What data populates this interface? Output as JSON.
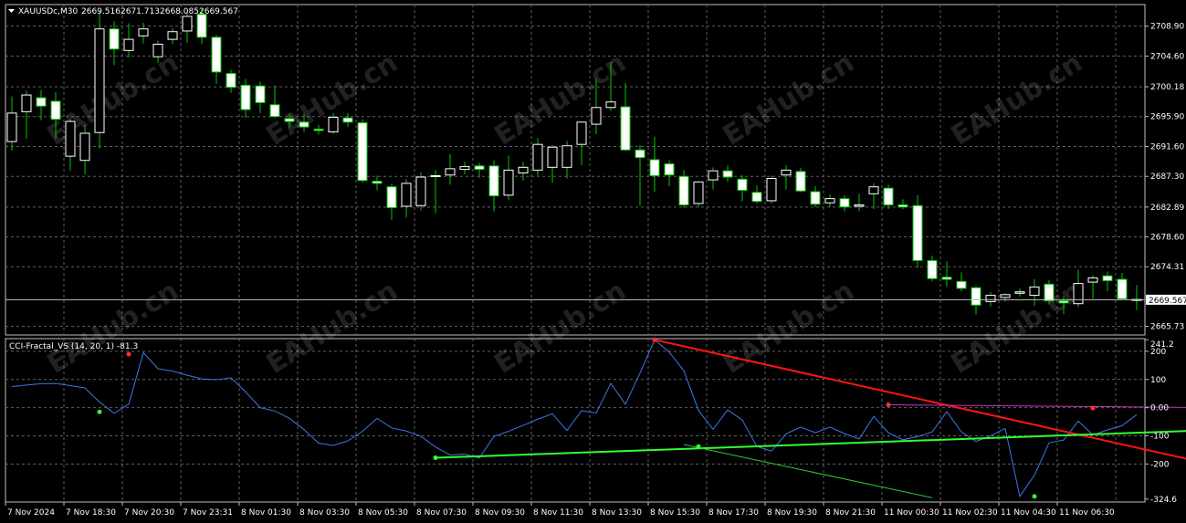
{
  "symbol_header": {
    "symbol": "XAUUSDc,M30",
    "open": "2669.516",
    "high": "2671.713",
    "low": "2668.085",
    "close": "2669.567"
  },
  "price_axis": {
    "labels": [
      "2708.90",
      "2704.60",
      "2700.18",
      "2695.90",
      "2691.60",
      "2687.30",
      "2682.89",
      "2678.60",
      "2674.31",
      "2665.73"
    ],
    "current_price": "2669.567"
  },
  "indicator": {
    "label": "CCI-Fractal_VS (14, 20, 1) -81.3",
    "axis_labels": [
      "241.2",
      "200",
      "100",
      "0.00",
      "-100",
      "-200",
      "-324.6"
    ]
  },
  "time_axis": {
    "labels": [
      "7 Nov 2024",
      "7 Nov 18:30",
      "7 Nov 20:30",
      "7 Nov 23:31",
      "8 Nov 01:30",
      "8 Nov 03:30",
      "8 Nov 05:30",
      "8 Nov 07:30",
      "8 Nov 09:30",
      "8 Nov 11:30",
      "8 Nov 13:30",
      "8 Nov 15:30",
      "8 Nov 17:30",
      "8 Nov 19:30",
      "8 Nov 21:30",
      "11 Nov 00:30",
      "11 Nov 02:30",
      "11 Nov 04:30",
      "11 Nov 06:30"
    ]
  },
  "watermark": "EAHub.cn",
  "colors": {
    "background": "#000000",
    "grid": "#606060",
    "candle_bull": "#ffffff",
    "candle_bear": "#ffffff",
    "wick": "#00c800",
    "cci_line": "#3c78e6",
    "trend_red": "#ff1414",
    "trend_green": "#32ff32",
    "trend_magenta": "#c832c8"
  },
  "chart_data": {
    "type": "candlestick",
    "symbol": "XAUUSDc",
    "timeframe": "M30",
    "ylim": [
      2664.5,
      2712.0
    ],
    "candles": [
      {
        "o": 2692.3,
        "h": 2698.8,
        "l": 2691.0,
        "c": 2696.4
      },
      {
        "o": 2696.6,
        "h": 2699.6,
        "l": 2692.7,
        "c": 2699.0
      },
      {
        "o": 2698.6,
        "h": 2699.7,
        "l": 2695.4,
        "c": 2697.4
      },
      {
        "o": 2698.1,
        "h": 2699.4,
        "l": 2692.7,
        "c": 2695.5
      },
      {
        "o": 2690.2,
        "h": 2695.5,
        "l": 2688.1,
        "c": 2695.2
      },
      {
        "o": 2689.6,
        "h": 2694.7,
        "l": 2687.6,
        "c": 2693.5
      },
      {
        "o": 2693.6,
        "h": 2711.1,
        "l": 2691.3,
        "c": 2708.5
      },
      {
        "o": 2708.5,
        "h": 2709.6,
        "l": 2703.3,
        "c": 2705.6
      },
      {
        "o": 2705.4,
        "h": 2709.3,
        "l": 2704.4,
        "c": 2707.0
      },
      {
        "o": 2707.5,
        "h": 2709.4,
        "l": 2706.4,
        "c": 2708.5
      },
      {
        "o": 2704.5,
        "h": 2706.8,
        "l": 2703.6,
        "c": 2706.3
      },
      {
        "o": 2707.0,
        "h": 2708.6,
        "l": 2706.3,
        "c": 2708.1
      },
      {
        "o": 2708.2,
        "h": 2711.2,
        "l": 2706.5,
        "c": 2710.3
      },
      {
        "o": 2710.6,
        "h": 2711.5,
        "l": 2706.3,
        "c": 2707.3
      },
      {
        "o": 2707.3,
        "h": 2707.6,
        "l": 2700.6,
        "c": 2702.3
      },
      {
        "o": 2702.1,
        "h": 2702.6,
        "l": 2699.3,
        "c": 2700.1
      },
      {
        "o": 2700.4,
        "h": 2701.3,
        "l": 2695.7,
        "c": 2696.9
      },
      {
        "o": 2700.3,
        "h": 2700.9,
        "l": 2696.4,
        "c": 2697.9
      },
      {
        "o": 2697.6,
        "h": 2700.4,
        "l": 2695.7,
        "c": 2695.9
      },
      {
        "o": 2695.6,
        "h": 2696.3,
        "l": 2694.2,
        "c": 2695.2
      },
      {
        "o": 2695.1,
        "h": 2696.3,
        "l": 2693.7,
        "c": 2694.4
      },
      {
        "o": 2694.1,
        "h": 2694.7,
        "l": 2693.3,
        "c": 2693.9
      },
      {
        "o": 2693.7,
        "h": 2696.4,
        "l": 2693.4,
        "c": 2695.8
      },
      {
        "o": 2695.7,
        "h": 2696.4,
        "l": 2694.4,
        "c": 2695.1
      },
      {
        "o": 2695.0,
        "h": 2695.5,
        "l": 2686.4,
        "c": 2686.7
      },
      {
        "o": 2686.6,
        "h": 2687.4,
        "l": 2685.3,
        "c": 2686.3
      },
      {
        "o": 2685.8,
        "h": 2686.2,
        "l": 2681.0,
        "c": 2682.8
      },
      {
        "o": 2683.0,
        "h": 2686.9,
        "l": 2681.4,
        "c": 2686.3
      },
      {
        "o": 2683.1,
        "h": 2687.9,
        "l": 2682.4,
        "c": 2687.2
      },
      {
        "o": 2687.4,
        "h": 2688.2,
        "l": 2682.0,
        "c": 2687.4
      },
      {
        "o": 2687.5,
        "h": 2690.5,
        "l": 2686.1,
        "c": 2688.4
      },
      {
        "o": 2688.3,
        "h": 2689.4,
        "l": 2687.6,
        "c": 2688.7
      },
      {
        "o": 2688.8,
        "h": 2689.2,
        "l": 2687.1,
        "c": 2688.3
      },
      {
        "o": 2688.8,
        "h": 2689.6,
        "l": 2682.3,
        "c": 2684.5
      },
      {
        "o": 2684.6,
        "h": 2690.3,
        "l": 2683.9,
        "c": 2688.2
      },
      {
        "o": 2687.8,
        "h": 2689.4,
        "l": 2686.7,
        "c": 2688.6
      },
      {
        "o": 2688.2,
        "h": 2692.8,
        "l": 2687.4,
        "c": 2691.9
      },
      {
        "o": 2688.6,
        "h": 2691.8,
        "l": 2686.4,
        "c": 2691.5
      },
      {
        "o": 2688.6,
        "h": 2692.4,
        "l": 2687.0,
        "c": 2691.7
      },
      {
        "o": 2691.9,
        "h": 2695.0,
        "l": 2688.9,
        "c": 2695.1
      },
      {
        "o": 2694.8,
        "h": 2701.3,
        "l": 2693.4,
        "c": 2697.2
      },
      {
        "o": 2697.2,
        "h": 2703.8,
        "l": 2696.7,
        "c": 2698.0
      },
      {
        "o": 2697.3,
        "h": 2700.7,
        "l": 2691.0,
        "c": 2691.1
      },
      {
        "o": 2691.1,
        "h": 2691.8,
        "l": 2683.1,
        "c": 2690.0
      },
      {
        "o": 2689.7,
        "h": 2693.0,
        "l": 2685.1,
        "c": 2687.4
      },
      {
        "o": 2689.1,
        "h": 2689.6,
        "l": 2685.9,
        "c": 2687.5
      },
      {
        "o": 2687.3,
        "h": 2688.2,
        "l": 2682.8,
        "c": 2683.2
      },
      {
        "o": 2683.4,
        "h": 2686.6,
        "l": 2682.9,
        "c": 2686.5
      },
      {
        "o": 2686.8,
        "h": 2688.6,
        "l": 2685.4,
        "c": 2688.1
      },
      {
        "o": 2688.1,
        "h": 2688.9,
        "l": 2686.5,
        "c": 2687.2
      },
      {
        "o": 2686.9,
        "h": 2687.5,
        "l": 2683.7,
        "c": 2685.3
      },
      {
        "o": 2685.0,
        "h": 2686.0,
        "l": 2683.4,
        "c": 2683.7
      },
      {
        "o": 2683.8,
        "h": 2687.4,
        "l": 2683.4,
        "c": 2687.0
      },
      {
        "o": 2687.5,
        "h": 2688.9,
        "l": 2685.4,
        "c": 2688.2
      },
      {
        "o": 2688.0,
        "h": 2688.5,
        "l": 2685.0,
        "c": 2685.2
      },
      {
        "o": 2685.1,
        "h": 2685.9,
        "l": 2682.9,
        "c": 2683.3
      },
      {
        "o": 2683.5,
        "h": 2684.7,
        "l": 2682.9,
        "c": 2684.1
      },
      {
        "o": 2684.1,
        "h": 2684.6,
        "l": 2682.3,
        "c": 2682.9
      },
      {
        "o": 2683.0,
        "h": 2684.8,
        "l": 2682.3,
        "c": 2683.2
      },
      {
        "o": 2684.8,
        "h": 2686.3,
        "l": 2682.6,
        "c": 2685.8
      },
      {
        "o": 2685.6,
        "h": 2686.1,
        "l": 2682.6,
        "c": 2683.2
      },
      {
        "o": 2683.2,
        "h": 2684.0,
        "l": 2682.6,
        "c": 2682.9
      },
      {
        "o": 2683.1,
        "h": 2684.6,
        "l": 2674.2,
        "c": 2675.2
      },
      {
        "o": 2675.2,
        "h": 2675.9,
        "l": 2672.2,
        "c": 2672.6
      },
      {
        "o": 2672.8,
        "h": 2675.1,
        "l": 2671.4,
        "c": 2672.5
      },
      {
        "o": 2672.2,
        "h": 2673.5,
        "l": 2670.8,
        "c": 2671.2
      },
      {
        "o": 2671.3,
        "h": 2671.5,
        "l": 2667.4,
        "c": 2668.8
      },
      {
        "o": 2669.3,
        "h": 2670.7,
        "l": 2668.6,
        "c": 2670.2
      },
      {
        "o": 2669.9,
        "h": 2670.5,
        "l": 2669.3,
        "c": 2670.3
      },
      {
        "o": 2670.5,
        "h": 2671.2,
        "l": 2670.0,
        "c": 2670.7
      },
      {
        "o": 2670.2,
        "h": 2672.5,
        "l": 2668.7,
        "c": 2671.4
      },
      {
        "o": 2671.8,
        "h": 2672.4,
        "l": 2668.9,
        "c": 2669.4
      },
      {
        "o": 2669.4,
        "h": 2670.1,
        "l": 2667.5,
        "c": 2669.1
      },
      {
        "o": 2669.0,
        "h": 2673.9,
        "l": 2668.5,
        "c": 2671.9
      },
      {
        "o": 2672.1,
        "h": 2673.1,
        "l": 2669.7,
        "c": 2672.7
      },
      {
        "o": 2673.0,
        "h": 2673.6,
        "l": 2670.8,
        "c": 2672.3
      },
      {
        "o": 2672.5,
        "h": 2673.4,
        "l": 2669.8,
        "c": 2669.7
      },
      {
        "o": 2669.5,
        "h": 2671.7,
        "l": 2668.1,
        "c": 2669.6
      }
    ],
    "cci": {
      "ylim": [
        -335,
        245
      ],
      "values": [
        75,
        80,
        85,
        86,
        78,
        70,
        20,
        -20,
        12,
        195,
        138,
        130,
        115,
        102,
        99,
        106,
        56,
        0,
        -12,
        -38,
        -78,
        -126,
        -134,
        -118,
        -84,
        -38,
        -72,
        -83,
        -102,
        -140,
        -168,
        -165,
        -179,
        -102,
        -84,
        -63,
        -41,
        -22,
        -81,
        -11,
        -19,
        86,
        12,
        123,
        241,
        197,
        131,
        -10,
        -77,
        -8,
        -44,
        -138,
        -154,
        -93,
        -69,
        -89,
        -69,
        -92,
        -111,
        -31,
        -89,
        -114,
        -103,
        -86,
        -14,
        -86,
        -120,
        -100,
        -74,
        -315,
        -240,
        -125,
        -115,
        -48,
        -97,
        -79,
        -64,
        -25
      ]
    },
    "trendlines": [
      {
        "color": "red",
        "from": [
          44,
          241
        ],
        "to": [
          82,
          -200
        ]
      },
      {
        "color": "green",
        "from": [
          29,
          -178
        ],
        "to": [
          82,
          -80
        ]
      },
      {
        "color": "magenta",
        "from": [
          60,
          10
        ],
        "to": [
          82,
          0
        ]
      },
      {
        "color": "green-thin",
        "from": [
          46,
          -131
        ],
        "to": [
          63,
          -320
        ]
      }
    ],
    "fractals_up": [
      [
        8,
        190
      ],
      [
        44,
        241
      ],
      [
        60,
        10
      ],
      [
        74,
        -2
      ]
    ],
    "fractals_down": [
      [
        6,
        -15
      ],
      [
        29,
        -178
      ],
      [
        47,
        -138
      ],
      [
        70,
        -315
      ]
    ]
  }
}
